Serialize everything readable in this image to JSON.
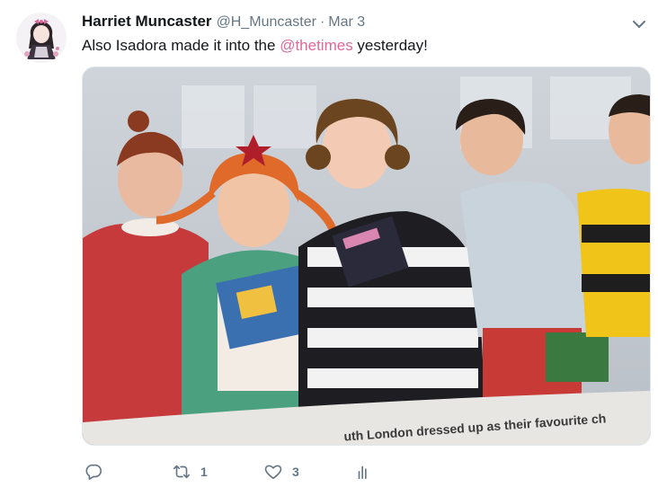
{
  "tweet": {
    "author_name": "Harriet Muncaster",
    "handle": "@H_Muncaster",
    "separator": "·",
    "time": "Mar 3",
    "text_before": "Also Isadora made it into the ",
    "mention": "@thetimes",
    "text_after": " yesterday!",
    "media_caption": "uth London dressed up as their favourite ch",
    "reply_icon": "reply-icon",
    "retweet_icon": "retweet-icon",
    "retweet_count": "1",
    "like_icon": "heart-icon",
    "like_count": "3",
    "analytics_icon": "analytics-icon",
    "menu_icon": "chevron-down-icon"
  },
  "colors": {
    "text": "#14171a",
    "muted": "#657786",
    "mention": "#e0679a",
    "border": "#e1e8ed"
  }
}
